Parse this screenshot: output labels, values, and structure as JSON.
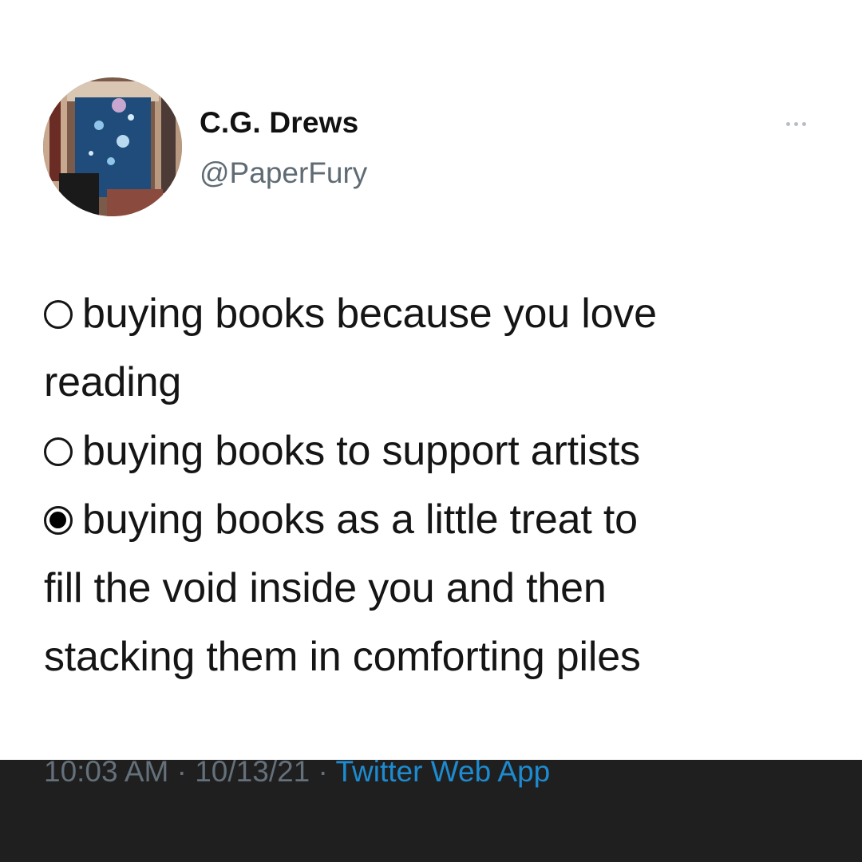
{
  "tweet": {
    "author": {
      "display_name": "C.G. Drews",
      "handle": "@PaperFury"
    },
    "poll_options": [
      {
        "text": "buying books because you love",
        "continuation": "reading",
        "selected": false
      },
      {
        "text": "buying books to support artists",
        "selected": false
      },
      {
        "text": "buying books as a little treat to",
        "continuation_1": "fill the void inside you and then",
        "continuation_2": "stacking them in comforting piles",
        "selected": true
      }
    ],
    "time": "10:03 AM",
    "separator": "·",
    "date": "10/13/21",
    "source": "Twitter Web App"
  },
  "colors": {
    "background_bars": "#1f1f1f",
    "card": "#ffffff",
    "text": "#151515",
    "muted_text": "#5f6b74",
    "link": "#1d8bd0"
  }
}
